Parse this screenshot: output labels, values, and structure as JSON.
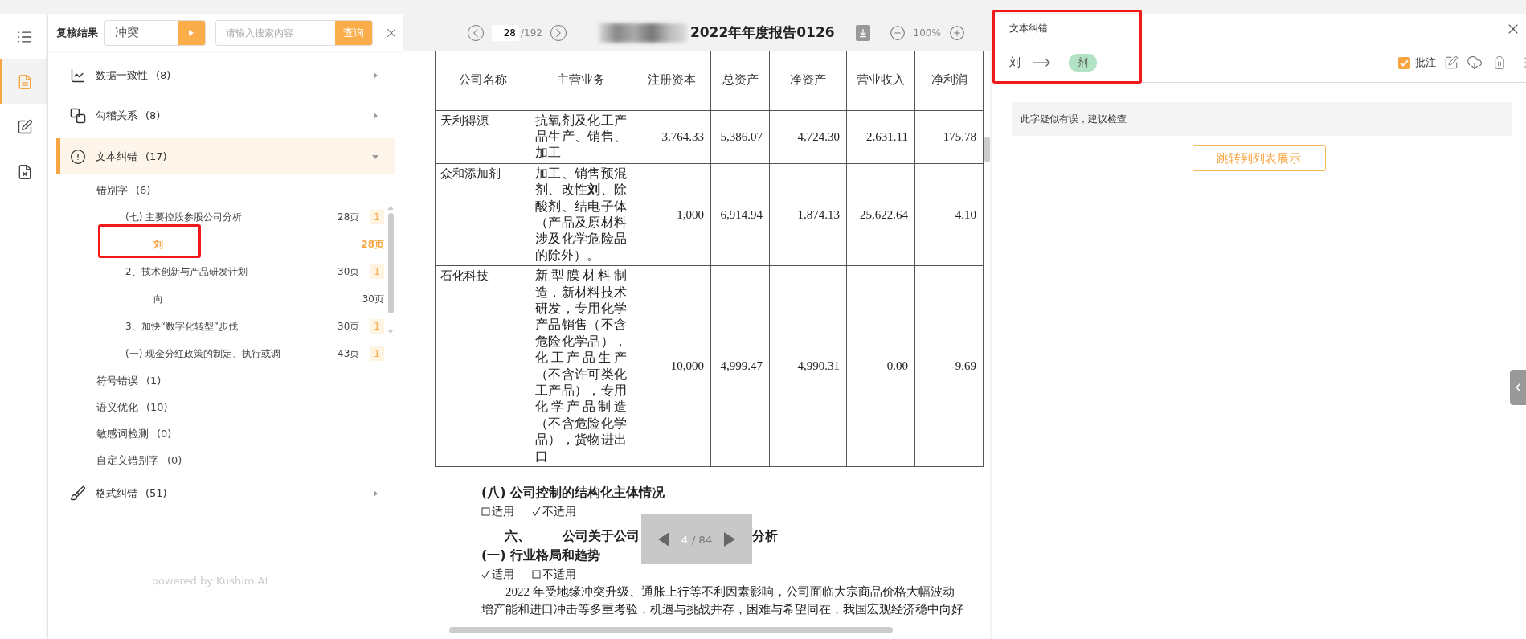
{
  "rail": [
    {
      "kind": "list",
      "selected": false
    },
    {
      "kind": "document",
      "selected": true
    },
    {
      "kind": "edit",
      "selected": false
    },
    {
      "kind": "file-x",
      "selected": false
    }
  ],
  "review_panel": {
    "title": "复核结果",
    "filter": {
      "value": "冲突"
    },
    "search": {
      "placeholder": "请输入搜索内容",
      "button": "查询"
    }
  },
  "categories": [
    {
      "kind": "chart",
      "label": "数据一致性",
      "count": "(8)",
      "expanded": false,
      "selected": false
    },
    {
      "kind": "link",
      "label": "勾稽关系",
      "count": "(8)",
      "expanded": false,
      "selected": false
    },
    {
      "kind": "alert",
      "label": "文本纠错",
      "count": "(17)",
      "expanded": true,
      "selected": true,
      "children": [
        {
          "label": "错别字",
          "count": "(6)",
          "children": [
            {
              "label": "(七) 主要控股参股公司分析",
              "page": "28页",
              "badge": "1",
              "children": [
                {
                  "label": "刘",
                  "page": "28页",
                  "selected": true
                }
              ]
            },
            {
              "label": "2、技术创新与产品研发计划",
              "page": "30页",
              "badge": "1",
              "children": [
                {
                  "label": "向",
                  "page": "30页",
                  "selected": false
                }
              ]
            },
            {
              "label": "3、加快“数字化转型”步伐",
              "page": "30页",
              "badge": "1"
            },
            {
              "label": "(一) 现金分红政策的制定、执行或调",
              "page": "43页",
              "badge": "1"
            }
          ]
        },
        {
          "label": "符号错误",
          "count": "(1)"
        },
        {
          "label": "语义优化",
          "count": "(10)"
        },
        {
          "label": "敏感词检测",
          "count": "(0)"
        },
        {
          "label": "自定义错别字",
          "count": "(0)"
        }
      ]
    },
    {
      "kind": "brush",
      "label": "格式纠错",
      "count": "(51)",
      "expanded": false,
      "selected": false
    }
  ],
  "footer": "powered by Kushim AI",
  "viewer": {
    "page": "28",
    "total": "/192",
    "title": "2022年年度报告0126",
    "zoom": "100%"
  },
  "table": {
    "columns": [
      "公司名称",
      "主营业务",
      "注册资本",
      "总资产",
      "净资产",
      "营业收入",
      "净利润"
    ],
    "rows": [
      [
        "天利得源",
        "抗氧剂及化工产品生产、销售、加工",
        "3,764.33",
        "5,386.07",
        "4,724.30",
        "2,631.11",
        "175.78"
      ],
      [
        "众和添加剂",
        "加工、销售预混剂、改性**刘**、除酸剂、结电子体（产品及原材料涉及化学危险品的除外）。",
        "1,000",
        "6,914.94",
        "1,874.13",
        "25,622.64",
        "4.10"
      ],
      [
        "石化科技",
        "新型膜材料制造，新材料技术研发，专用化学产品销售（不含危险化学品），化工产品生产（不含许可类化工产品），专用化学产品制造（不含危险化学品），货物进出口",
        "10,000",
        "4,999.47",
        "4,990.31",
        "0.00",
        "-9.69"
      ]
    ]
  },
  "sections": [
    {
      "heading": "(八) 公司控制的结构化主体情况",
      "options": [
        {
          "label": "适用",
          "checked": false
        },
        {
          "label": "不适用",
          "checked": true
        }
      ]
    }
  ],
  "chapter": {
    "number": "六、",
    "title_start": "公司关于公司",
    "title_end": "分析"
  },
  "subsection": {
    "heading": "(一) 行业格局和趋势",
    "options": [
      {
        "label": "适用",
        "checked": true
      },
      {
        "label": "不适用",
        "checked": false
      }
    ],
    "lines": [
      "2022 年受地缘冲突升级、通胀上行等不利因素影响，公司面临大宗商品价格大幅波动",
      "增产能和进口冲击等多重考验，机遇与挑战并存，困难与希望同在，我国宏观经济稳中向好"
    ]
  },
  "pager": {
    "current": "4",
    "total": "/ 84"
  },
  "detail": {
    "title": "文本纠错",
    "original": "刘",
    "suggestion": "剂",
    "annotate": {
      "label": "批注",
      "checked": true
    },
    "comment": "此字疑似有误，建议检查",
    "jump_button": "跳转到列表展示"
  }
}
